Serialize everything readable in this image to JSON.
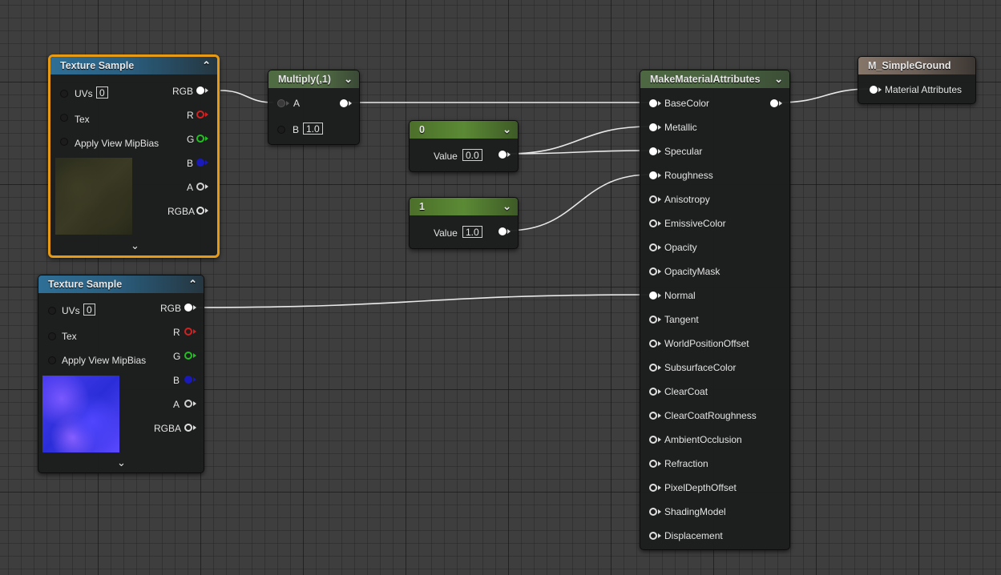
{
  "texture_sample_1": {
    "title": "Texture Sample",
    "uvs_label": "UVs",
    "uvs_value": "0",
    "tex_label": "Tex",
    "mipbias_label": "Apply View MipBias",
    "outputs": [
      "RGB",
      "R",
      "G",
      "B",
      "A",
      "RGBA"
    ],
    "preview_colors": [
      "#2b2d1d",
      "#3b3a24",
      "#252718"
    ]
  },
  "texture_sample_2": {
    "title": "Texture Sample",
    "uvs_label": "UVs",
    "uvs_value": "0",
    "tex_label": "Tex",
    "mipbias_label": "Apply View MipBias",
    "outputs": [
      "RGB",
      "R",
      "G",
      "B",
      "A",
      "RGBA"
    ],
    "preview_colors": [
      "#4a3cf0",
      "#2a2ed8",
      "#7a58ff"
    ]
  },
  "multiply": {
    "title": "Multiply(,1)",
    "input_a": "A",
    "input_b": "B",
    "b_value": "1.0"
  },
  "param_zero": {
    "title": "0",
    "value_label": "Value",
    "value": "0.0"
  },
  "param_one": {
    "title": "1",
    "value_label": "Value",
    "value": "1.0"
  },
  "make_material_attributes": {
    "title": "MakeMaterialAttributes",
    "inputs": [
      "BaseColor",
      "Metallic",
      "Specular",
      "Roughness",
      "Anisotropy",
      "EmissiveColor",
      "Opacity",
      "OpacityMask",
      "Normal",
      "Tangent",
      "WorldPositionOffset",
      "SubsurfaceColor",
      "ClearCoat",
      "ClearCoatRoughness",
      "AmbientOcclusion",
      "Refraction",
      "PixelDepthOffset",
      "ShadingModel",
      "Displacement"
    ],
    "connected": [
      "BaseColor",
      "Metallic",
      "Specular",
      "Roughness",
      "Normal"
    ]
  },
  "result_node": {
    "title": "M_SimpleGround",
    "input": "Material Attributes"
  },
  "colors": {
    "selected_border": "#e69a16",
    "pin_red": "#d42020",
    "pin_green": "#22c022",
    "pin_blue": "#1a1ab8",
    "pin_white": "#ffffff",
    "wire": "#e8e8e8"
  }
}
